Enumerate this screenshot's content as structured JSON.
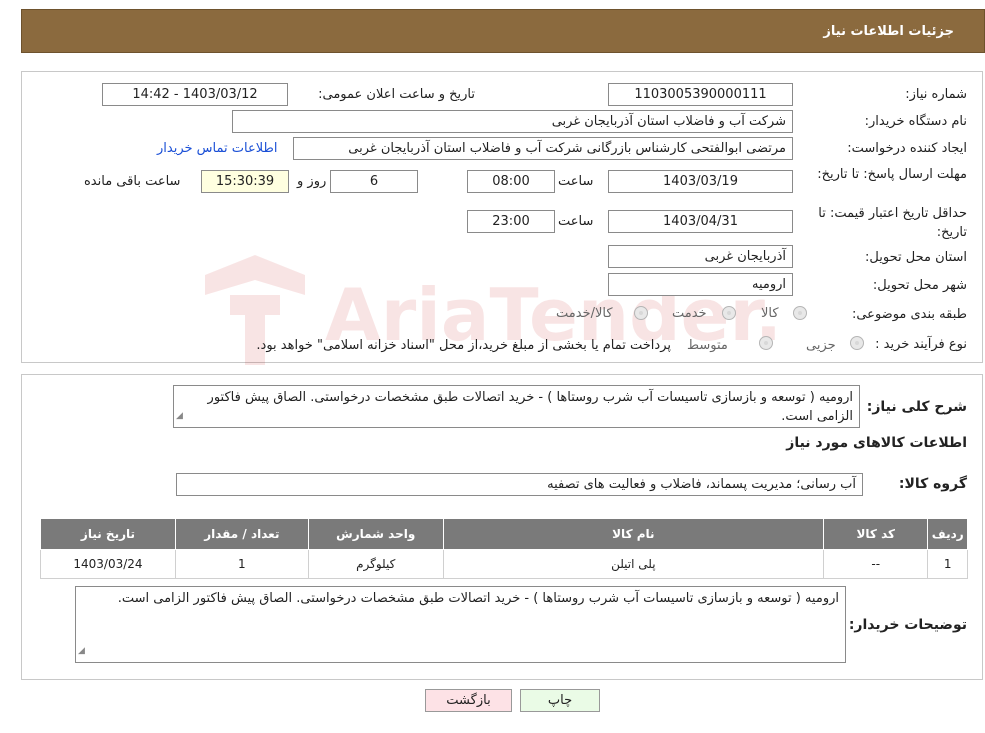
{
  "header": {
    "title": "جزئیات اطلاعات نیاز"
  },
  "form": {
    "need_number_label": "شماره نیاز:",
    "need_number": "1103005390000111",
    "announce_label": "تاریخ و ساعت اعلان عمومی:",
    "announce_value": "1403/03/12 - 14:42",
    "buyer_org_label": "نام دستگاه خریدار:",
    "buyer_org": "شرکت آب و فاضلاب استان آذربایجان غربی",
    "creator_label": "ایجاد کننده درخواست:",
    "creator": "مرتضی ابوالفتحی کارشناس بازرگانی شرکت آب و فاضلاب استان آذربایجان غربی",
    "contact_link": "اطلاعات تماس خریدار",
    "reply_deadline_label": "مهلت ارسال پاسخ: تا تاریخ:",
    "reply_date": "1403/03/19",
    "time_label": "ساعت",
    "reply_time": "08:00",
    "days": "6",
    "days_label": "روز و",
    "remaining_time": "15:30:39",
    "remaining_label": "ساعت باقی مانده",
    "price_validity_label": "حداقل تاریخ اعتبار قیمت: تا تاریخ:",
    "price_date": "1403/04/31",
    "price_time": "23:00",
    "province_label": "استان محل تحویل:",
    "province": "آذربایجان غربی",
    "city_label": "شهر محل تحویل:",
    "city": "ارومیه",
    "category_label": "طبقه بندی موضوعی:",
    "category_options": [
      "کالا",
      "خدمت",
      "کالا/خدمت"
    ],
    "process_label": "نوع فرآیند خرید :",
    "process_options": [
      "جزیی",
      "متوسط"
    ],
    "process_note": "پرداخت تمام یا بخشی از مبلغ خرید،از محل \"اسناد خزانه اسلامی\" خواهد بود."
  },
  "description": {
    "label": "شرح کلی نیاز:",
    "text": "ارومیه ( توسعه و بازسازی تاسیسات آب شرب روستاها ) - خرید اتصالات طبق مشخصات درخواستی. الصاق پیش فاکتور الزامی است."
  },
  "goods": {
    "section_title": "اطلاعات کالاهای مورد نیاز",
    "group_label": "گروه کالا:",
    "group_value": "آب رسانی؛ مدیریت پسماند، فاضلاب و فعالیت های تصفیه",
    "columns": [
      "ردیف",
      "کد کالا",
      "نام کالا",
      "واحد شمارش",
      "تعداد / مقدار",
      "تاریخ نیاز"
    ],
    "rows": [
      [
        "1",
        "--",
        "پلی اتیلن",
        "کیلوگرم",
        "1",
        "1403/03/24"
      ]
    ]
  },
  "buyer_notes": {
    "label": "توضیحات خریدار:",
    "text": "ارومیه ( توسعه و بازسازی تاسیسات آب شرب روستاها ) - خرید اتصالات طبق مشخصات درخواستی. الصاق پیش فاکتور الزامی است."
  },
  "buttons": {
    "print": "چاپ",
    "back": "بازگشت"
  },
  "watermark": {
    "text": "AriaTender.neT"
  }
}
